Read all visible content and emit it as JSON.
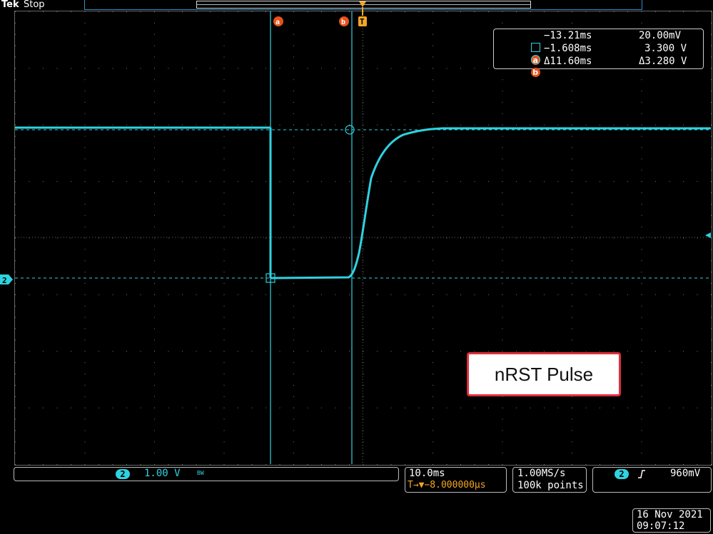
{
  "header": {
    "brand": "Tek",
    "status": "Stop"
  },
  "cursors": {
    "a_label": "a",
    "b_label": "b",
    "trigger_marker": "T",
    "readout": {
      "a_time": "−13.21ms",
      "a_volt": "20.00mV",
      "b_time": "−1.608ms",
      "b_volt": "3.300 V",
      "delta_time": "Δ11.60ms",
      "delta_volt": "Δ3.280 V"
    }
  },
  "channel_marker": "2",
  "annotation": "nRST Pulse",
  "channel_panel": {
    "channel": "2",
    "scale": "1.00 V",
    "bw": "BW"
  },
  "horizontal_panel": {
    "timebase": "10.0ms",
    "trigger_pos": "T→▼−8.000000µs"
  },
  "acquisition_panel": {
    "rate": "1.00MS/s",
    "points": "100k points"
  },
  "trigger_panel": {
    "channel": "2",
    "slope_icon": "rising-edge-icon",
    "level": "960mV"
  },
  "datetime": {
    "date": "16 Nov 2021",
    "time": "09:07:12"
  },
  "colors": {
    "trace": "#2fd2e0",
    "cursor_badge": "#e8511c",
    "trigger": "#f5a623",
    "annotation_border": "#e02f3c"
  }
}
